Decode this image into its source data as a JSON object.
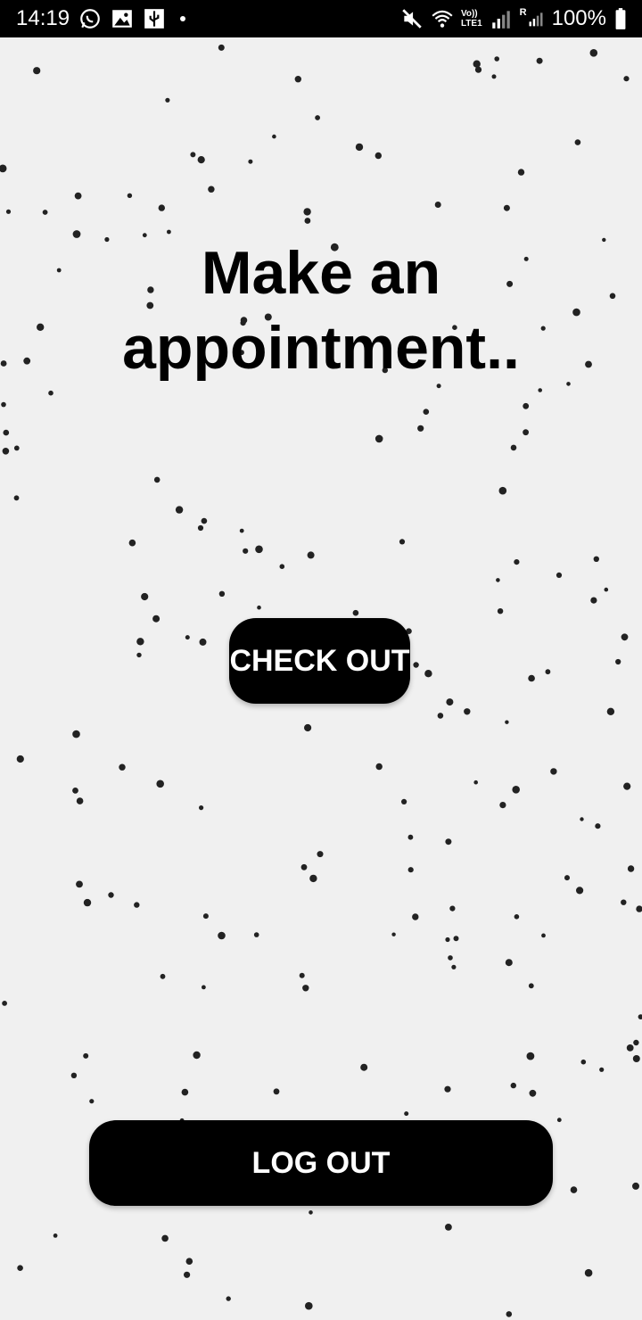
{
  "status_bar": {
    "time": "14:19",
    "left_icons": [
      "whatsapp-icon",
      "image-icon",
      "usb-icon"
    ],
    "right_icons": [
      "mute-icon",
      "wifi-icon",
      "volte-icon",
      "signal-icon",
      "roaming-signal-icon"
    ],
    "volte_label_top": "Vo))",
    "volte_label_bottom": "LTE1",
    "roaming_label": "R",
    "battery": "100%"
  },
  "main": {
    "title": "Make an\nappointment..",
    "checkout_label": "CHECK OUT",
    "logout_label": "LOG OUT"
  },
  "colors": {
    "background": "#f0f0f0",
    "button": "#000000",
    "button_text": "#ffffff",
    "status_bar": "#000000"
  }
}
